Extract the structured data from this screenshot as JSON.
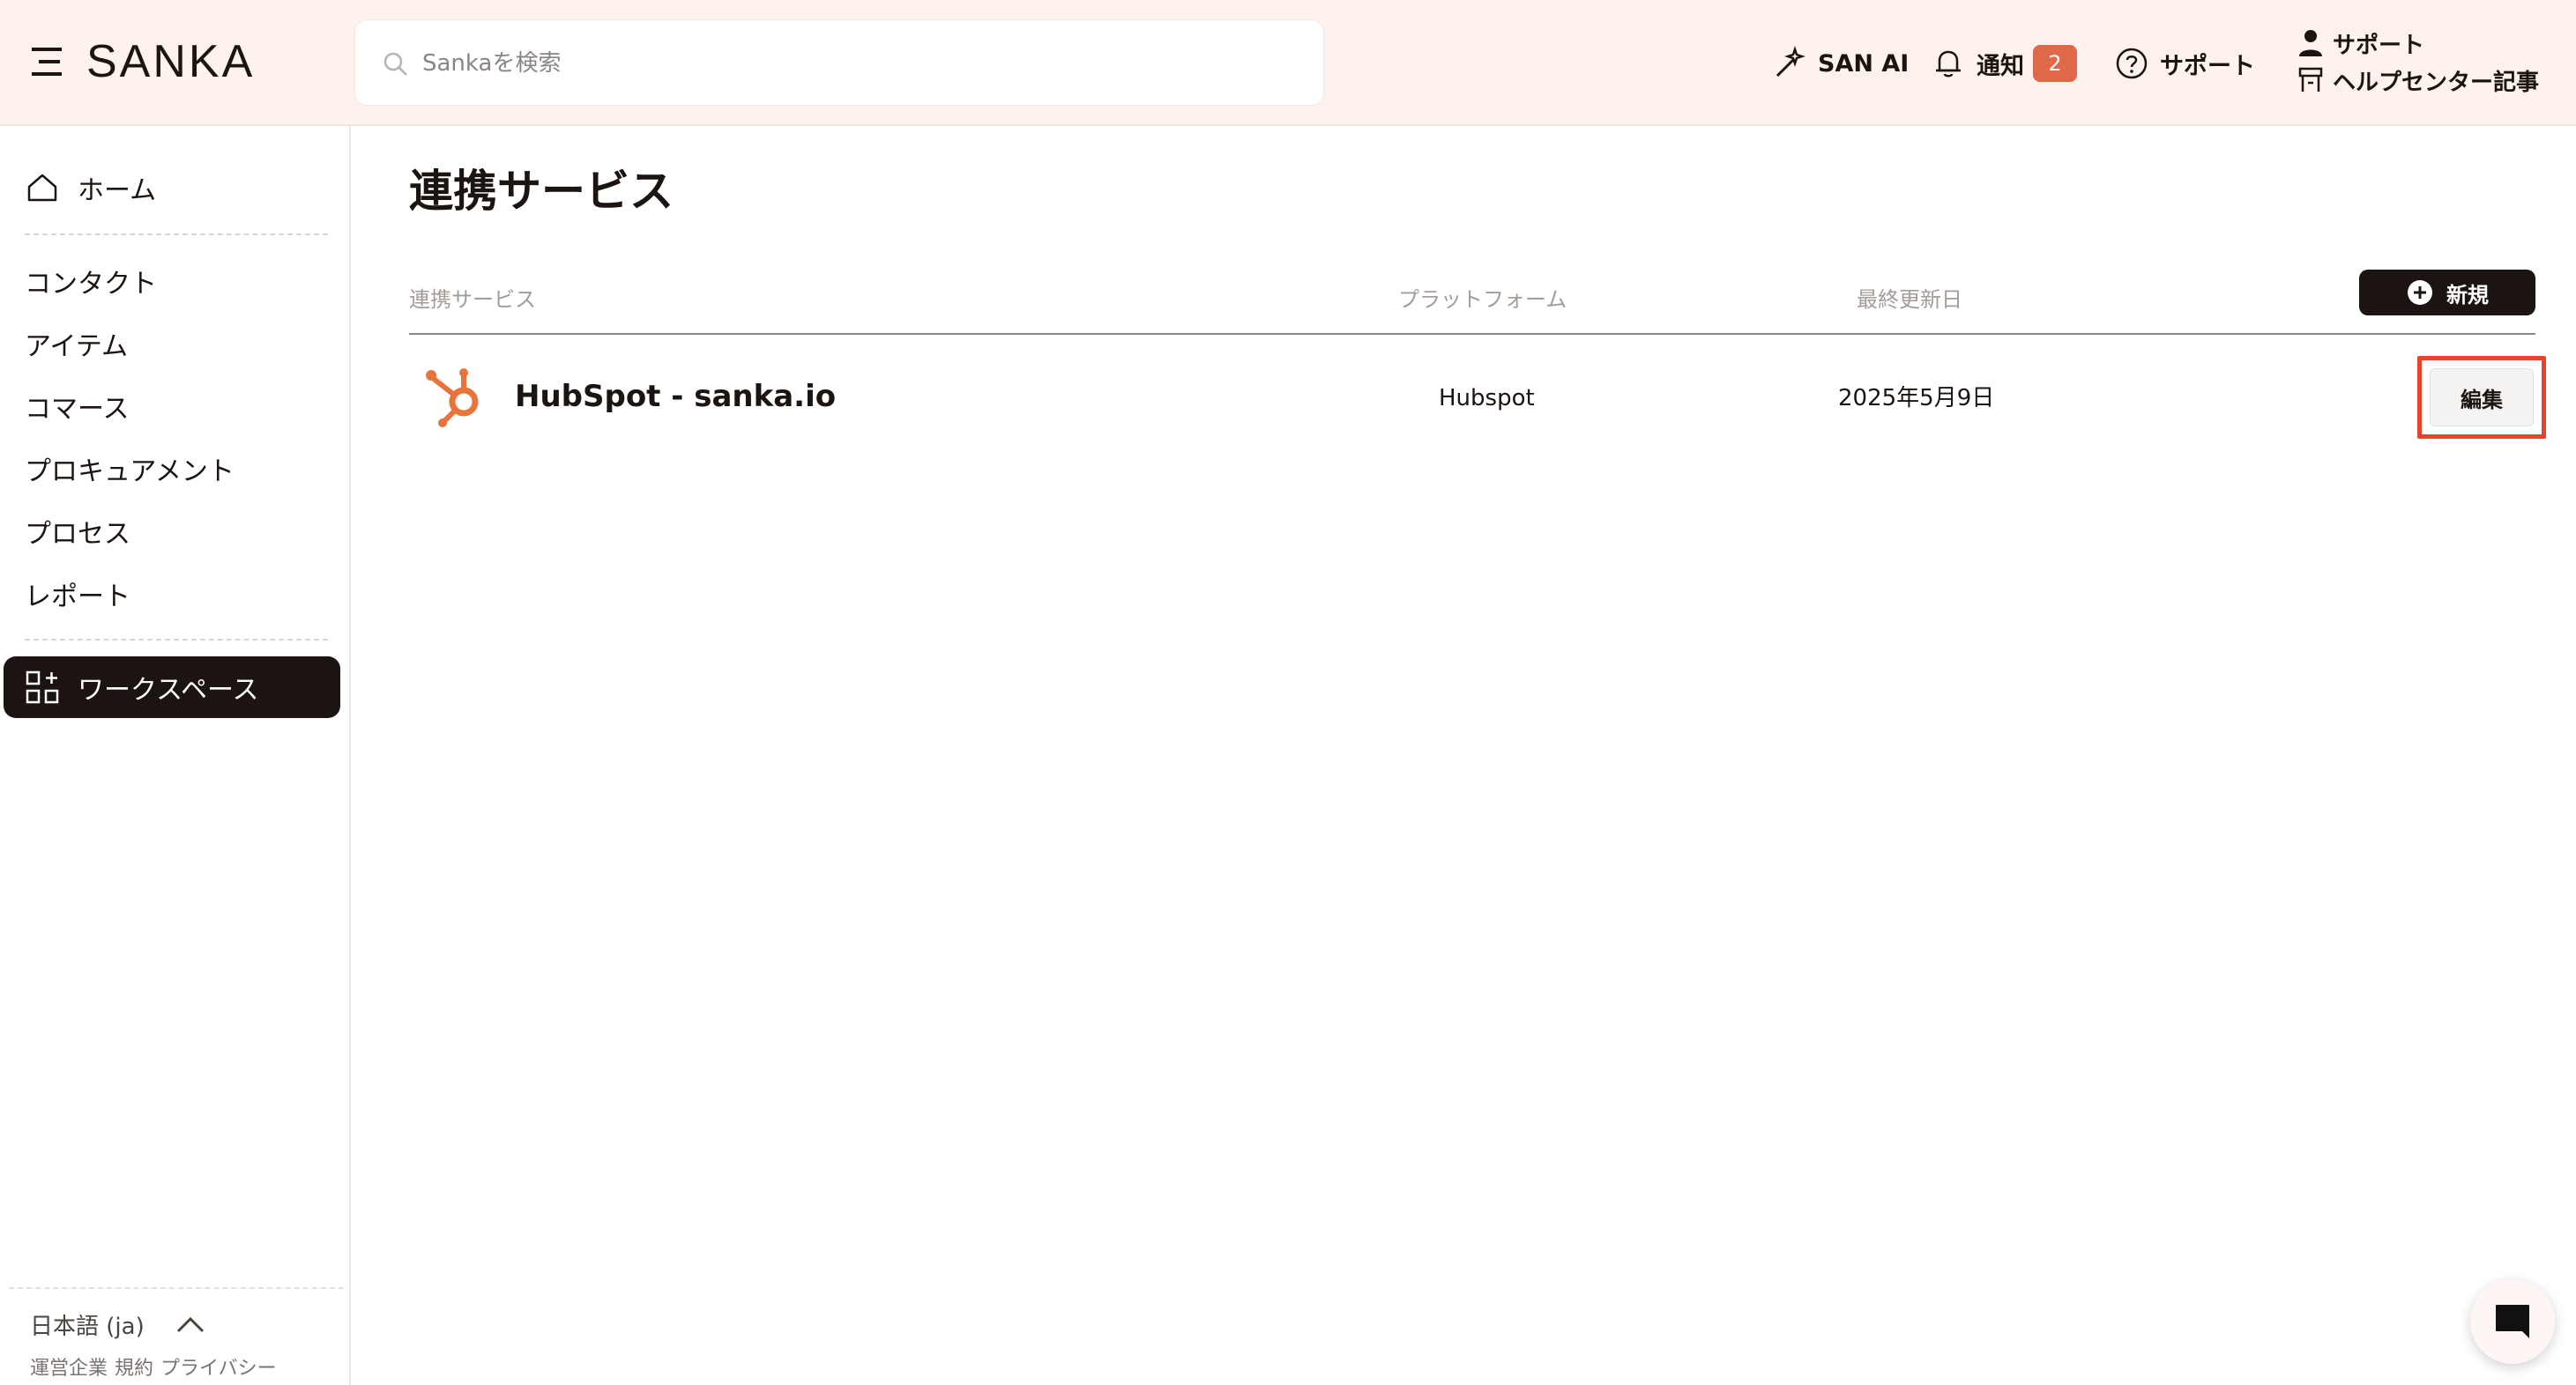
{
  "app": {
    "logo": "SANKA",
    "search_placeholder": "Sankaを検索"
  },
  "header": {
    "san_ai": "SAN AI",
    "notifications": "通知",
    "notification_count": "2",
    "support": "サポート",
    "support_menu": {
      "support": "サポート",
      "help_center": "ヘルプセンター記事"
    }
  },
  "sidebar": {
    "home": "ホーム",
    "items": [
      "コンタクト",
      "アイテム",
      "コマース",
      "プロキュアメント",
      "プロセス",
      "レポート"
    ],
    "workspace": "ワークスペース",
    "language": "日本語 (ja)",
    "footer_links": [
      "運営企業",
      "規約",
      "プライバシー"
    ]
  },
  "main": {
    "title": "連携サービス",
    "columns": {
      "service": "連携サービス",
      "platform": "プラットフォーム",
      "updated": "最終更新日"
    },
    "new_button": "新規",
    "rows": [
      {
        "name": "HubSpot - sanka.io",
        "platform": "Hubspot",
        "updated": "2025年5月9日",
        "action": "編集"
      }
    ]
  },
  "colors": {
    "header_bg": "#fdf2ee",
    "dark": "#1c1410",
    "badge": "#e0694a",
    "hubspot": "#e8743b",
    "highlight": "#e8442b"
  }
}
